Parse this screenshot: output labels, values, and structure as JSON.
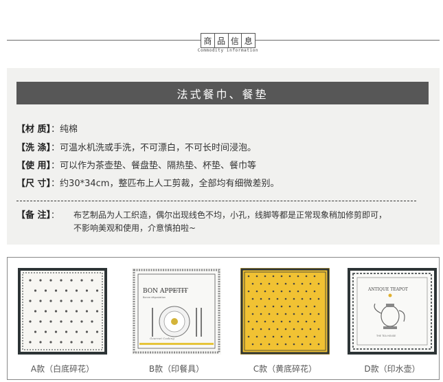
{
  "header": {
    "chars": [
      "商",
      "品",
      "信",
      "息"
    ],
    "subtitle": "Commodity information"
  },
  "info": {
    "title": "法式餐巾、餐垫",
    "rows": [
      {
        "key": "【材 质】",
        "value": "纯棉"
      },
      {
        "key": "【洗 涤】",
        "value": "可温水机洗或手洗，不可漂白，不可长时间浸泡。"
      },
      {
        "key": "【使 用】",
        "value": "可以作为茶壶垫、餐盘垫、隔热垫、杯垫、餐巾等"
      },
      {
        "key": "【尺 寸】",
        "value": "约30*34cm，整匹布上人工剪裁，全部均有细微差别。"
      }
    ],
    "note": {
      "key": "【备 注】",
      "value": "布艺制品为人工织造，偶尔出现线色不均，小孔，线脚等都是正常现象稍加修剪即可，不影响美观和使用，介意慎拍啦~"
    }
  },
  "products": [
    {
      "label": "A款（白底碎花）",
      "bg": "#f7f6f2",
      "border": "#2d3436"
    },
    {
      "label": "B款（印餐具）",
      "bg": "#f8f8f6",
      "border": "#7f7f7f",
      "printed": {
        "title": "BON APPETIT",
        "sub": "Bonne dégustation",
        "footer": "LA BONNE CUISINE",
        "script": "Gourmet Cooking"
      }
    },
    {
      "label": "C款（黄底碎花）",
      "bg": "#f1c233",
      "border": "#2d3436"
    },
    {
      "label": "D款（印水壶）",
      "bg": "#f9f9f7",
      "border": "#2d3436",
      "printed": {
        "title": "ANTIQUE TEAPOT",
        "footer": "THE TEA HOUSE"
      }
    }
  ]
}
